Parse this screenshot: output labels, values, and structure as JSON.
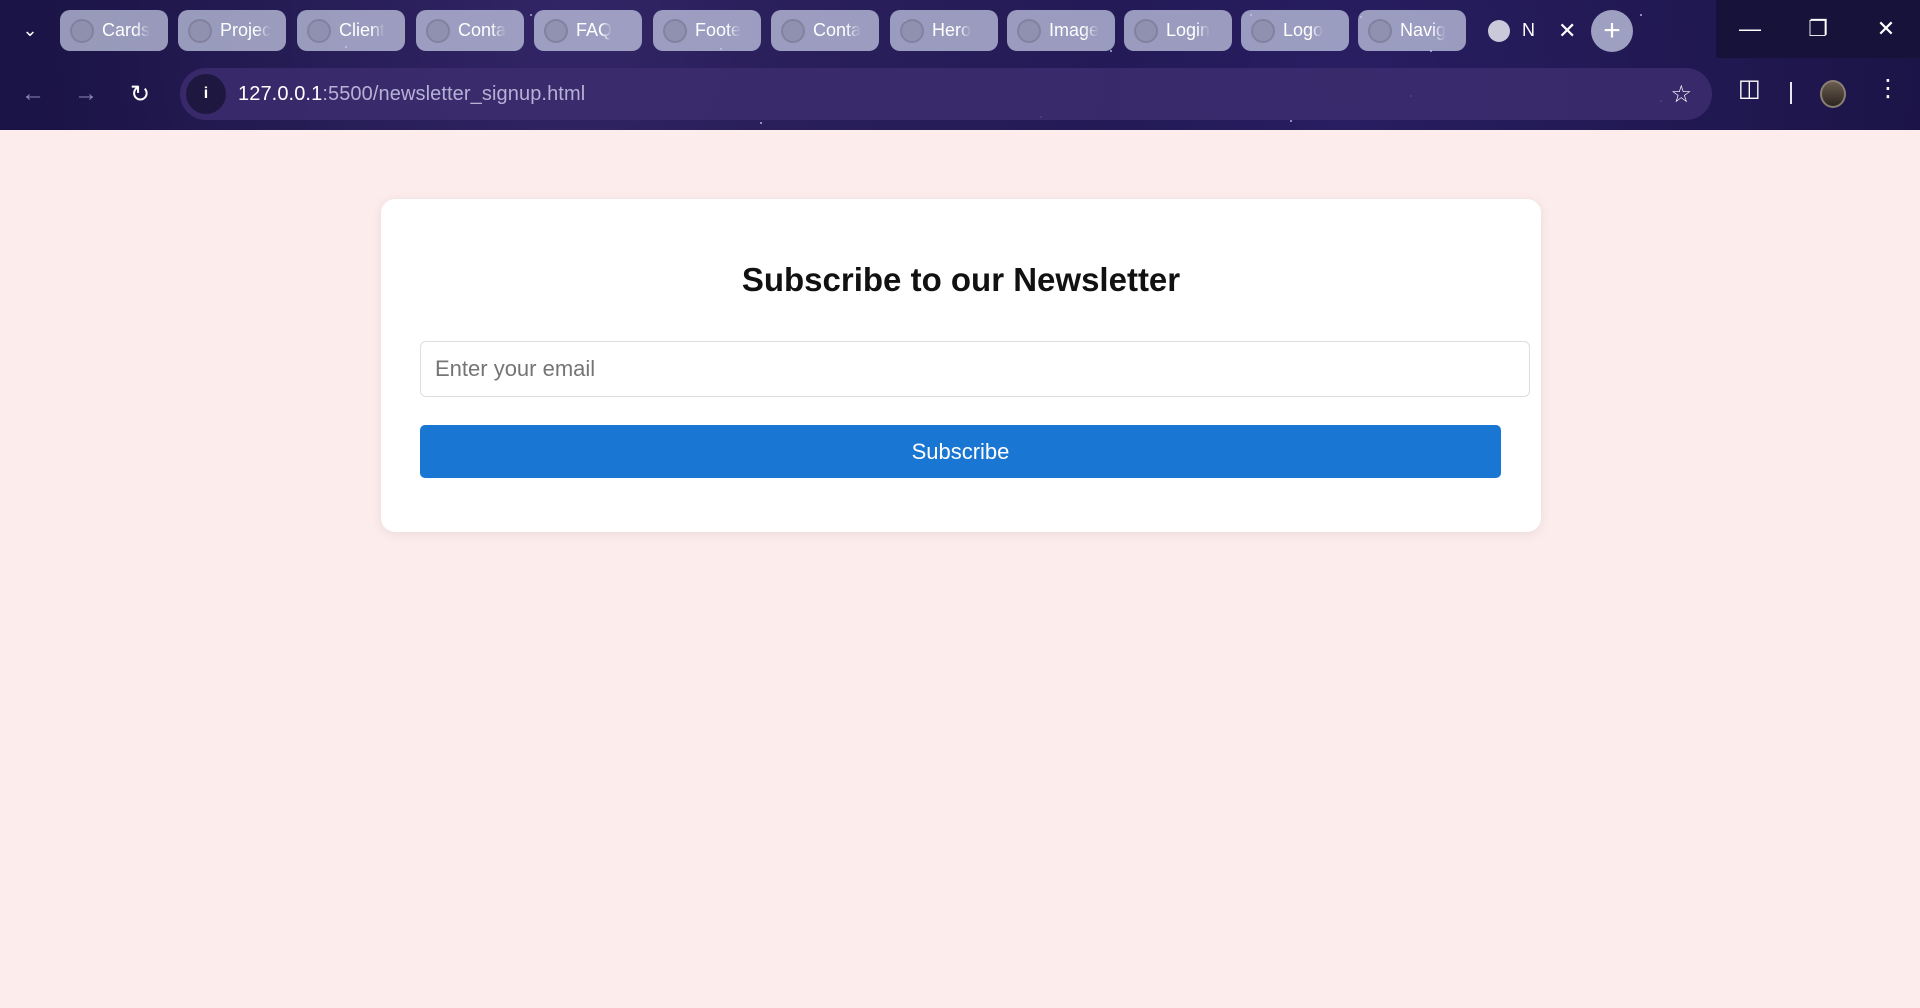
{
  "browser": {
    "tabs": [
      {
        "label": "Cards"
      },
      {
        "label": "Projec"
      },
      {
        "label": "Client"
      },
      {
        "label": "Conta"
      },
      {
        "label": "FAQ"
      },
      {
        "label": "Foote"
      },
      {
        "label": "Conta"
      },
      {
        "label": "Hero"
      },
      {
        "label": "Image"
      },
      {
        "label": "Login"
      },
      {
        "label": "Logo"
      },
      {
        "label": "Navig"
      }
    ],
    "active_tab": {
      "label": "N"
    },
    "url_host": "127.0.0.1",
    "url_path": ":5500/newsletter_signup.html"
  },
  "icons": {
    "tab_search": "chevron-down-icon",
    "back": "arrow-left-icon",
    "forward": "arrow-right-icon",
    "reload": "reload-icon",
    "info": "info-icon",
    "bookmark": "star-icon",
    "extensions": "puzzle-icon",
    "menu": "kebab-menu-icon",
    "new_tab": "plus-icon",
    "minimize": "minimize-icon",
    "restore": "restore-icon",
    "close": "close-icon"
  },
  "newsletter": {
    "title": "Subscribe to our Newsletter",
    "email_placeholder": "Enter your email",
    "email_value": "",
    "button_label": "Subscribe"
  },
  "colors": {
    "page_background": "#fdecec",
    "button": "#1976d2",
    "chrome_background": "#1b1446"
  }
}
